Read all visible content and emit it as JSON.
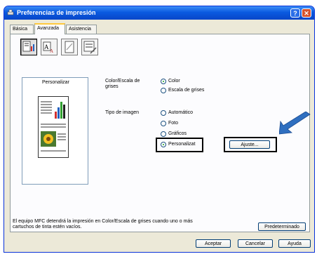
{
  "window": {
    "title": "Preferencias de impresión",
    "help_btn": "?",
    "close_btn": "✕"
  },
  "tabs": [
    {
      "label": "Básica"
    },
    {
      "label": "Avanzada"
    },
    {
      "label": "Asistencia"
    }
  ],
  "preview": {
    "label": "Personalizar"
  },
  "color_section": {
    "label": "Color/Escala de grises",
    "options": [
      {
        "label": "Color",
        "selected": true
      },
      {
        "label": "Escala de grises",
        "selected": false
      }
    ]
  },
  "image_section": {
    "label": "Tipo de imagen",
    "options": [
      {
        "label": "Automático",
        "selected": false
      },
      {
        "label": "Foto",
        "selected": false
      },
      {
        "label": "Gráficos",
        "selected": false
      },
      {
        "label": "Personalizat",
        "selected": true
      }
    ],
    "settings_button": "Ajuste..."
  },
  "footer": {
    "message": "El equipo MFC detendrá la impresión en Color/Escala de grises cuando uno o más cartuchos de tinta estén vacíos.",
    "default_button": "Predeterminado",
    "ok_button": "Aceptar",
    "cancel_button": "Cancelar",
    "help_button": "Ayuda"
  },
  "colors": {
    "title_bar": "#0a5ae0",
    "pointer_arrow": "#2f6fc0",
    "radio_dot": "#21a121"
  }
}
